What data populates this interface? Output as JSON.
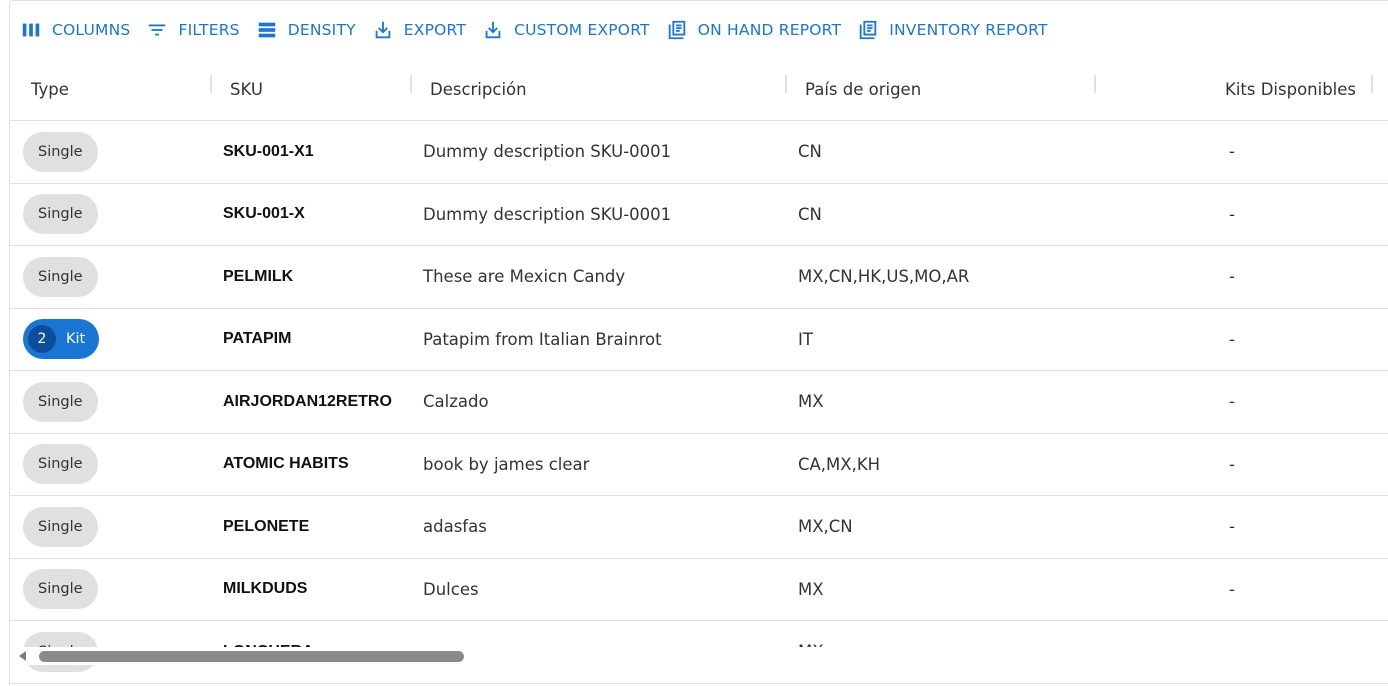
{
  "toolbar": {
    "columns": "COLUMNS",
    "filters": "FILTERS",
    "density": "DENSITY",
    "export": "EXPORT",
    "custom_export": "CUSTOM EXPORT",
    "on_hand_report": "ON HAND REPORT",
    "inventory_report": "INVENTORY REPORT"
  },
  "header": {
    "type": "Type",
    "sku": "SKU",
    "description": "Descripción",
    "country": "País de origen",
    "kits": "Kits Disponibles"
  },
  "rows": [
    {
      "type": "Single",
      "sku": "SKU-001-X1",
      "description": "Dummy description SKU-0001",
      "country": "CN",
      "kits": "-"
    },
    {
      "type": "Single",
      "sku": "SKU-001-X",
      "description": "Dummy description SKU-0001",
      "country": "CN",
      "kits": "-"
    },
    {
      "type": "Single",
      "sku": "PELMILK",
      "description": "These are Mexicn Candy",
      "country": "MX,CN,HK,US,MO,AR",
      "kits": "-"
    },
    {
      "type": "Kit",
      "kit_count": "2",
      "sku": "PATAPIM",
      "description": "Patapim from Italian Brainrot",
      "country": "IT",
      "kits": "-"
    },
    {
      "type": "Single",
      "sku": "AIRJORDAN12RETRO",
      "description": "Calzado",
      "country": "MX",
      "kits": "-"
    },
    {
      "type": "Single",
      "sku": "ATOMIC HABITS",
      "description": "book by james clear",
      "country": "CA,MX,KH",
      "kits": "-"
    },
    {
      "type": "Single",
      "sku": "PELONETE",
      "description": "adasfas",
      "country": "MX,CN",
      "kits": "-"
    },
    {
      "type": "Single",
      "sku": "MILKDUDS",
      "description": "Dulces",
      "country": "MX",
      "kits": "-"
    },
    {
      "type": "Single",
      "sku": "LONCHERA",
      "description": "",
      "country": "MX",
      "kits": ""
    }
  ],
  "colors": {
    "accent": "#1976d2",
    "chip_bg": "#e0e0e0",
    "kit_count_bg": "#0d4e9a"
  }
}
